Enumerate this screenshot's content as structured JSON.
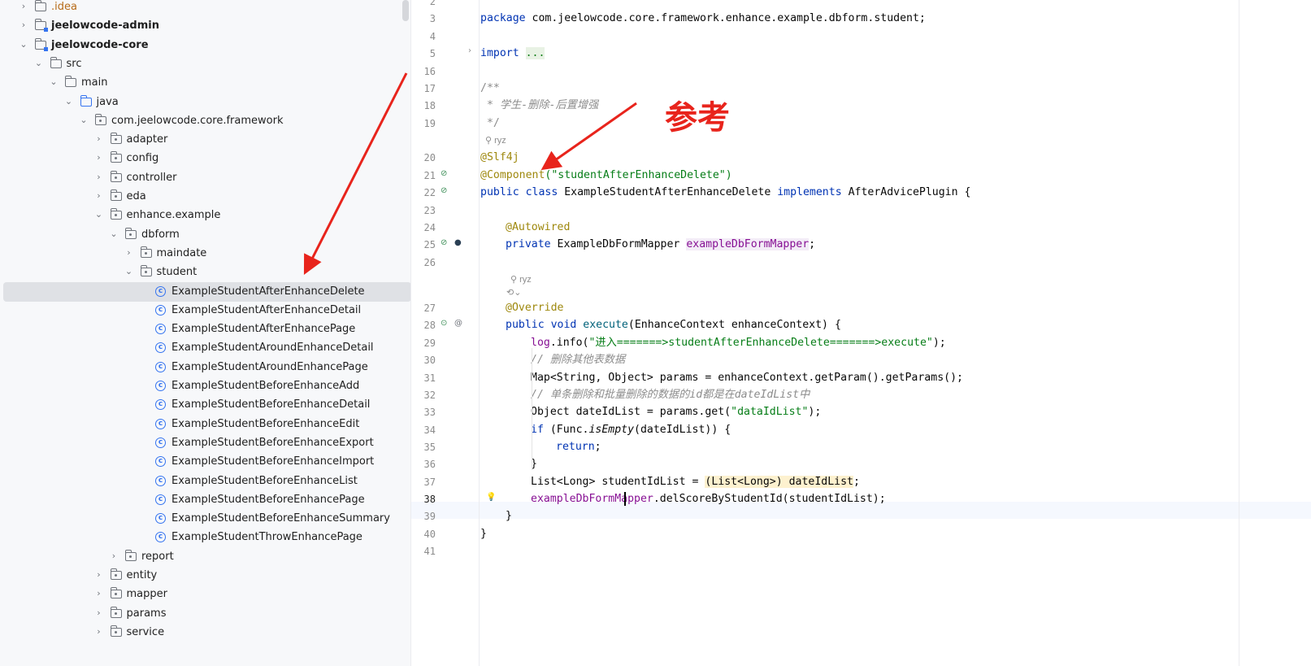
{
  "project_tree": {
    "items": [
      {
        "label": ".idea",
        "depth": 1,
        "kind": "folder",
        "expanded": false
      },
      {
        "label": "jeelowcode-admin",
        "depth": 1,
        "kind": "module",
        "expanded": false
      },
      {
        "label": "jeelowcode-core",
        "depth": 1,
        "kind": "module",
        "expanded": true
      },
      {
        "label": "src",
        "depth": 2,
        "kind": "folder",
        "expanded": true
      },
      {
        "label": "main",
        "depth": 3,
        "kind": "folder",
        "expanded": true
      },
      {
        "label": "java",
        "depth": 4,
        "kind": "source-folder",
        "expanded": true
      },
      {
        "label": "com.jeelowcode.core.framework",
        "depth": 5,
        "kind": "package",
        "expanded": true
      },
      {
        "label": "adapter",
        "depth": 6,
        "kind": "package",
        "expanded": false
      },
      {
        "label": "config",
        "depth": 6,
        "kind": "package",
        "expanded": false
      },
      {
        "label": "controller",
        "depth": 6,
        "kind": "package",
        "expanded": false
      },
      {
        "label": "eda",
        "depth": 6,
        "kind": "package",
        "expanded": false
      },
      {
        "label": "enhance.example",
        "depth": 6,
        "kind": "package",
        "expanded": true
      },
      {
        "label": "dbform",
        "depth": 7,
        "kind": "package",
        "expanded": true
      },
      {
        "label": "maindate",
        "depth": 8,
        "kind": "package",
        "expanded": false
      },
      {
        "label": "student",
        "depth": 8,
        "kind": "package",
        "expanded": true
      },
      {
        "label": "ExampleStudentAfterEnhanceDelete",
        "depth": 9,
        "kind": "class",
        "selected": true
      },
      {
        "label": "ExampleStudentAfterEnhanceDetail",
        "depth": 9,
        "kind": "class"
      },
      {
        "label": "ExampleStudentAfterEnhancePage",
        "depth": 9,
        "kind": "class"
      },
      {
        "label": "ExampleStudentAroundEnhanceDetail",
        "depth": 9,
        "kind": "class"
      },
      {
        "label": "ExampleStudentAroundEnhancePage",
        "depth": 9,
        "kind": "class"
      },
      {
        "label": "ExampleStudentBeforeEnhanceAdd",
        "depth": 9,
        "kind": "class"
      },
      {
        "label": "ExampleStudentBeforeEnhanceDetail",
        "depth": 9,
        "kind": "class"
      },
      {
        "label": "ExampleStudentBeforeEnhanceEdit",
        "depth": 9,
        "kind": "class"
      },
      {
        "label": "ExampleStudentBeforeEnhanceExport",
        "depth": 9,
        "kind": "class"
      },
      {
        "label": "ExampleStudentBeforeEnhanceImport",
        "depth": 9,
        "kind": "class"
      },
      {
        "label": "ExampleStudentBeforeEnhanceList",
        "depth": 9,
        "kind": "class"
      },
      {
        "label": "ExampleStudentBeforeEnhancePage",
        "depth": 9,
        "kind": "class"
      },
      {
        "label": "ExampleStudentBeforeEnhanceSummary",
        "depth": 9,
        "kind": "class"
      },
      {
        "label": "ExampleStudentThrowEnhancePage",
        "depth": 9,
        "kind": "class"
      },
      {
        "label": "report",
        "depth": 7,
        "kind": "package",
        "expanded": false
      },
      {
        "label": "entity",
        "depth": 6,
        "kind": "package",
        "expanded": false
      },
      {
        "label": "mapper",
        "depth": 6,
        "kind": "package",
        "expanded": false
      },
      {
        "label": "params",
        "depth": 6,
        "kind": "package",
        "expanded": false
      },
      {
        "label": "service",
        "depth": 6,
        "kind": "package",
        "expanded": false
      }
    ]
  },
  "editor": {
    "line_numbers": [
      "2",
      "3",
      "4",
      "5",
      "16",
      "17",
      "18",
      "19",
      "20",
      "21",
      "22",
      "23",
      "24",
      "25",
      "26",
      "27",
      "28",
      "29",
      "30",
      "31",
      "32",
      "33",
      "34",
      "35",
      "36",
      "37",
      "38",
      "39",
      "40",
      "41"
    ],
    "current_line": "38",
    "author_hint": "ryz",
    "code": {
      "package_kw": "package",
      "package_name": " com.jeelowcode.core.framework.enhance.example.dbform.student;",
      "import_kw": "import",
      "import_fold": "...",
      "doc_open": "/**",
      "doc_text": " * 学生-删除-后置增强",
      "doc_close": " */",
      "ann_slf4j": "@Slf4j",
      "ann_component": "@Component",
      "component_arg": "(\"studentAfterEnhanceDelete\")",
      "class_decl_kw": "public class",
      "class_name": " ExampleStudentAfterEnhanceDelete ",
      "implements_kw": "implements",
      "interface_name": " AfterAdvicePlugin {",
      "ann_autowired": "@Autowired",
      "field_kw": "private",
      "field_type": " ExampleDbFormMapper ",
      "field_name": "exampleDbFormMapper",
      "field_end": ";",
      "ann_override": "@Override",
      "method_kw": "public void",
      "method_name": " execute",
      "method_params": "(EnhanceContext enhanceContext) {",
      "log_call": "log",
      "log_info": ".info(",
      "log_str": "\"进入=======>studentAfterEnhanceDelete=======>execute\"",
      "log_end": ");",
      "comment1": "// 删除其他表数据",
      "params_line": "Map<String, Object> params = enhanceContext.getParam().getParams();",
      "comment2": "// 单条删除和批量删除的数据的id都是在dateIdList中",
      "obj_line_a": "Object dateIdList = params.get(",
      "obj_line_str": "\"dataIdList\"",
      "obj_line_b": ");",
      "if_kw": "if",
      "if_a": " (Func.",
      "if_m": "isEmpty",
      "if_b": "(dateIdList)) {",
      "return_kw": "return",
      "return_end": ";",
      "close_brace": "}",
      "list_line_a": "List<Long> studentIdList = ",
      "list_line_b": "(List<Long>) dateIdList",
      "list_line_c": ";",
      "mapper_call_a": "exampleDbFormMapper",
      "mapper_call_b": ".delScoreByStudentId(studentIdList);"
    }
  },
  "annotation_note": "参考",
  "colors": {
    "arrow": "#e8241c",
    "selection": "#dfe1e5",
    "keyword": "#0033b3",
    "string": "#067d17"
  }
}
